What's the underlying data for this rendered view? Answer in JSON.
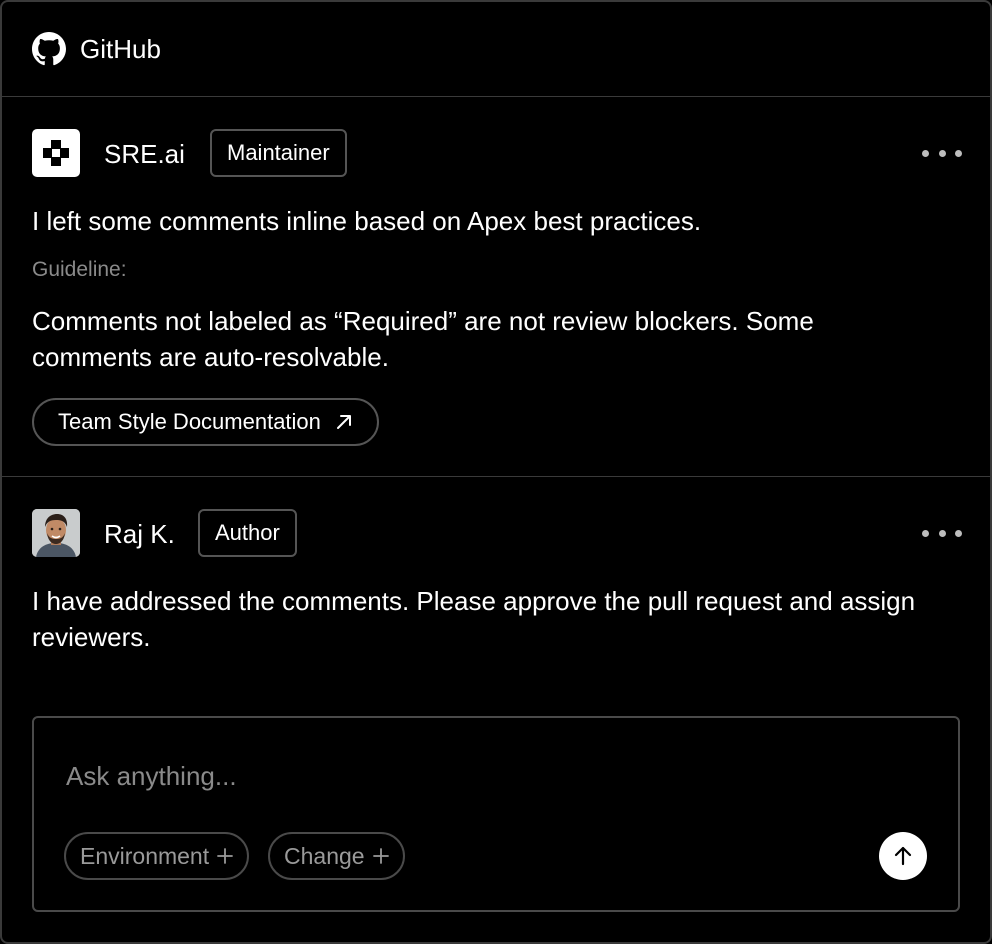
{
  "header": {
    "title": "GitHub",
    "icon": "github-icon"
  },
  "comments": [
    {
      "author": "SRE.ai",
      "role": "Maintainer",
      "avatar_icon": "sre-logo-icon",
      "message": "I left some comments inline based on Apex best practices.",
      "guideline_label": "Guideline:",
      "guideline_text": "Comments not labeled as “Required” are not review blockers. Some comments are auto-resolvable.",
      "link_label": "Team Style Documentation",
      "link_icon": "external-link-arrow-icon",
      "more_icon": "more-horizontal-icon"
    },
    {
      "author": "Raj K.",
      "role": "Author",
      "avatar_icon": "user-avatar",
      "message": "I have addressed the comments. Please approve the pull request and assign reviewers.",
      "more_icon": "more-horizontal-icon"
    }
  ],
  "composer": {
    "placeholder": "Ask anything...",
    "value": "",
    "chips": [
      {
        "label": "Environment",
        "icon": "plus-icon"
      },
      {
        "label": "Change",
        "icon": "plus-icon"
      }
    ],
    "send_icon": "arrow-up-icon"
  },
  "colors": {
    "background": "#000000",
    "border": "#3a3a3a",
    "text": "#ffffff",
    "muted": "#8a8a8a",
    "send_button": "#ffffff"
  }
}
